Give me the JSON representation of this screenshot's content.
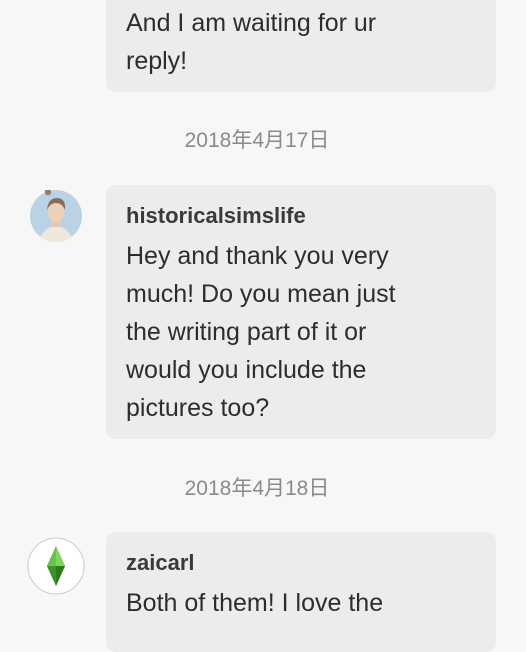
{
  "messages": [
    {
      "sender": "",
      "text": "And I am waiting for ur\nreply!"
    },
    {
      "date_separator": "2018年4月17日",
      "sender": "historicalsimslife",
      "avatar_icon": "sim-portrait-avatar-icon",
      "text": "Hey and thank you very\nmuch! Do you mean just\nthe writing part of it or\nwould you include the\npictures too?"
    },
    {
      "date_separator": "2018年4月18日",
      "sender": "zaicarl",
      "avatar_icon": "sims-plumbob-avatar-icon",
      "text": "Both of them! I love the"
    }
  ],
  "colors": {
    "background": "#f7f7f7",
    "bubble": "#ececec",
    "text": "#2d2d2d",
    "date": "#8a8a8a",
    "plumbob_green": "#5bbf3a"
  }
}
